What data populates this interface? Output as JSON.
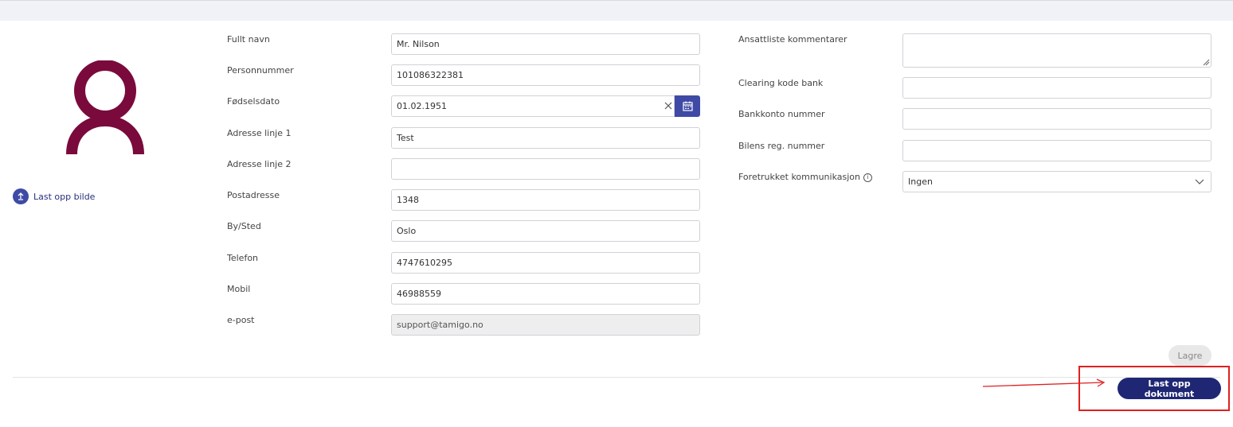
{
  "profile": {
    "upload_photo_label": "Last opp bilde"
  },
  "form_left": {
    "full_name": {
      "label": "Fullt navn",
      "value": "Mr. Nilson"
    },
    "person_no": {
      "label": "Personnummer",
      "value": "101086322381"
    },
    "birth_date": {
      "label": "Fødselsdato",
      "value": "01.02.1951"
    },
    "address1": {
      "label": "Adresse linje 1",
      "value": "Test"
    },
    "address2": {
      "label": "Adresse linje 2",
      "value": ""
    },
    "postal": {
      "label": "Postadresse",
      "value": "1348"
    },
    "city": {
      "label": "By/Sted",
      "value": "Oslo"
    },
    "phone": {
      "label": "Telefon",
      "value": "4747610295"
    },
    "mobile": {
      "label": "Mobil",
      "value": "46988559"
    },
    "email": {
      "label": "e-post",
      "value": "support@tamigo.no"
    }
  },
  "form_right": {
    "comments": {
      "label": "Ansattliste kommentarer",
      "value": ""
    },
    "clearing_code": {
      "label": "Clearing kode bank",
      "value": ""
    },
    "bank_account": {
      "label": "Bankkonto nummer",
      "value": ""
    },
    "car_reg": {
      "label": "Bilens reg. nummer",
      "value": ""
    },
    "communication": {
      "label": "Foretrukket kommunikasjon",
      "selected": "Ingen",
      "info_icon": "i"
    }
  },
  "actions": {
    "save_label": "Lagre",
    "upload_document_label": "Last opp dokument"
  },
  "colors": {
    "accent": "#3f4aa6",
    "dark_button": "#1f2774",
    "avatar": "#7a0a3c",
    "highlight": "#e02020"
  }
}
